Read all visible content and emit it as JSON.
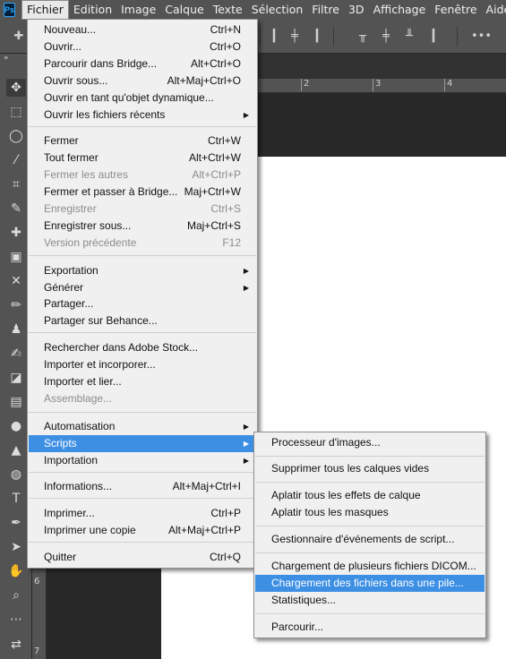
{
  "app": {
    "logo": "Ps"
  },
  "menubar": {
    "items": [
      "Fichier",
      "Edition",
      "Image",
      "Calque",
      "Texte",
      "Sélection",
      "Filtre",
      "3D",
      "Affichage",
      "Fenêtre",
      "Aide"
    ]
  },
  "optionsbar": {
    "more": "•••"
  },
  "tools": {
    "collapse": "»"
  },
  "ruler": {
    "h": [
      "2",
      "3",
      "4"
    ],
    "v": [
      "6",
      "7"
    ]
  },
  "fichier_menu": {
    "items": [
      {
        "label": "Nouveau...",
        "shortcut": "Ctrl+N"
      },
      {
        "label": "Ouvrir...",
        "shortcut": "Ctrl+O"
      },
      {
        "label": "Parcourir dans Bridge...",
        "shortcut": "Alt+Ctrl+O"
      },
      {
        "label": "Ouvrir sous...",
        "shortcut": "Alt+Maj+Ctrl+O"
      },
      {
        "label": "Ouvrir en tant qu'objet dynamique...",
        "shortcut": ""
      },
      {
        "label": "Ouvrir les fichiers récents",
        "shortcut": ""
      },
      {
        "label": "Fermer",
        "shortcut": "Ctrl+W"
      },
      {
        "label": "Tout fermer",
        "shortcut": "Alt+Ctrl+W"
      },
      {
        "label": "Fermer les autres",
        "shortcut": "Alt+Ctrl+P"
      },
      {
        "label": "Fermer et passer à Bridge...",
        "shortcut": "Maj+Ctrl+W"
      },
      {
        "label": "Enregistrer",
        "shortcut": "Ctrl+S"
      },
      {
        "label": "Enregistrer sous...",
        "shortcut": "Maj+Ctrl+S"
      },
      {
        "label": "Version précédente",
        "shortcut": "F12"
      },
      {
        "label": "Exportation",
        "shortcut": ""
      },
      {
        "label": "Générer",
        "shortcut": ""
      },
      {
        "label": "Partager...",
        "shortcut": ""
      },
      {
        "label": "Partager sur Behance...",
        "shortcut": ""
      },
      {
        "label": "Rechercher dans Adobe Stock...",
        "shortcut": ""
      },
      {
        "label": "Importer et incorporer...",
        "shortcut": ""
      },
      {
        "label": "Importer et lier...",
        "shortcut": ""
      },
      {
        "label": "Assemblage...",
        "shortcut": ""
      },
      {
        "label": "Automatisation",
        "shortcut": ""
      },
      {
        "label": "Scripts",
        "shortcut": ""
      },
      {
        "label": "Importation",
        "shortcut": ""
      },
      {
        "label": "Informations...",
        "shortcut": "Alt+Maj+Ctrl+I"
      },
      {
        "label": "Imprimer...",
        "shortcut": "Ctrl+P"
      },
      {
        "label": "Imprimer une copie",
        "shortcut": "Alt+Maj+Ctrl+P"
      },
      {
        "label": "Quitter",
        "shortcut": "Ctrl+Q"
      }
    ]
  },
  "scripts_menu": {
    "items": [
      "Processeur d'images...",
      "Supprimer tous les calques vides",
      "Aplatir tous les effets de calque",
      "Aplatir tous les masques",
      "Gestionnaire d'événements de script...",
      "Chargement de plusieurs fichiers DICOM...",
      "Chargement des fichiers dans une pile...",
      "Statistiques...",
      "Parcourir..."
    ]
  }
}
